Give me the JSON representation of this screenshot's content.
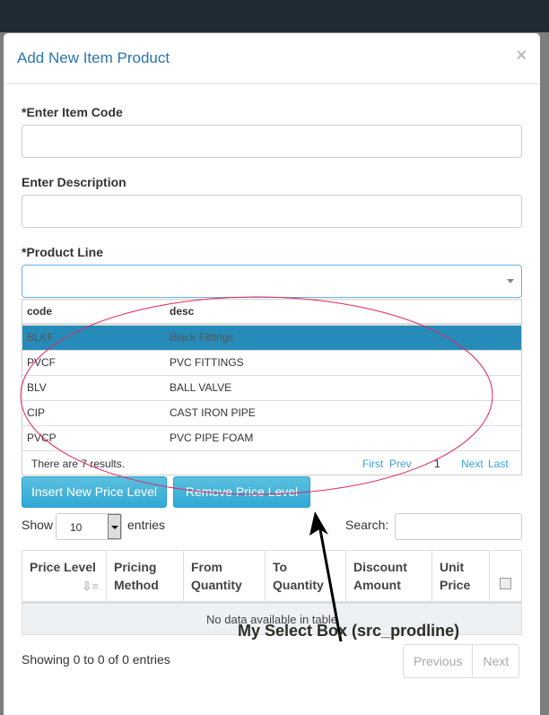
{
  "modal": {
    "title": "Add New Item Product",
    "close": "×"
  },
  "form": {
    "item_code_label": "*Enter Item Code",
    "item_code_value": "",
    "description_label": "Enter Description",
    "description_value": "",
    "product_line_label": "*Product Line",
    "product_line_value": ""
  },
  "dropdown": {
    "headers": [
      "code",
      "desc"
    ],
    "rows": [
      {
        "code": "BLKF",
        "desc": "Black Fittings",
        "selected": true
      },
      {
        "code": "PVCF",
        "desc": "PVC FITTINGS"
      },
      {
        "code": "BLV",
        "desc": "BALL VALVE"
      },
      {
        "code": "CIP",
        "desc": "CAST IRON PIPE"
      },
      {
        "code": "PVCP",
        "desc": "PVC PIPE FOAM"
      }
    ],
    "results": "There are 7 results.",
    "first": "First",
    "prev": "Prev",
    "page": "1",
    "next": "Next",
    "last": "Last"
  },
  "buttons": {
    "insert": "Insert New Price Level",
    "remove": "Remove Price Level"
  },
  "table": {
    "show": "Show",
    "length": "10",
    "entries": "entries",
    "search_label": "Search:",
    "search_value": "",
    "columns": [
      "Price Level",
      "Pricing Method",
      "From Quantity",
      "To Quantity",
      "Discount Amount",
      "Unit Price"
    ],
    "empty": "No data available in table",
    "info": "Showing 0 to 0 of 0 entries",
    "previous": "Previous",
    "next": "Next"
  },
  "annotation": {
    "text": "My Select Box (src_prodline)",
    "color": "#e0245e"
  }
}
